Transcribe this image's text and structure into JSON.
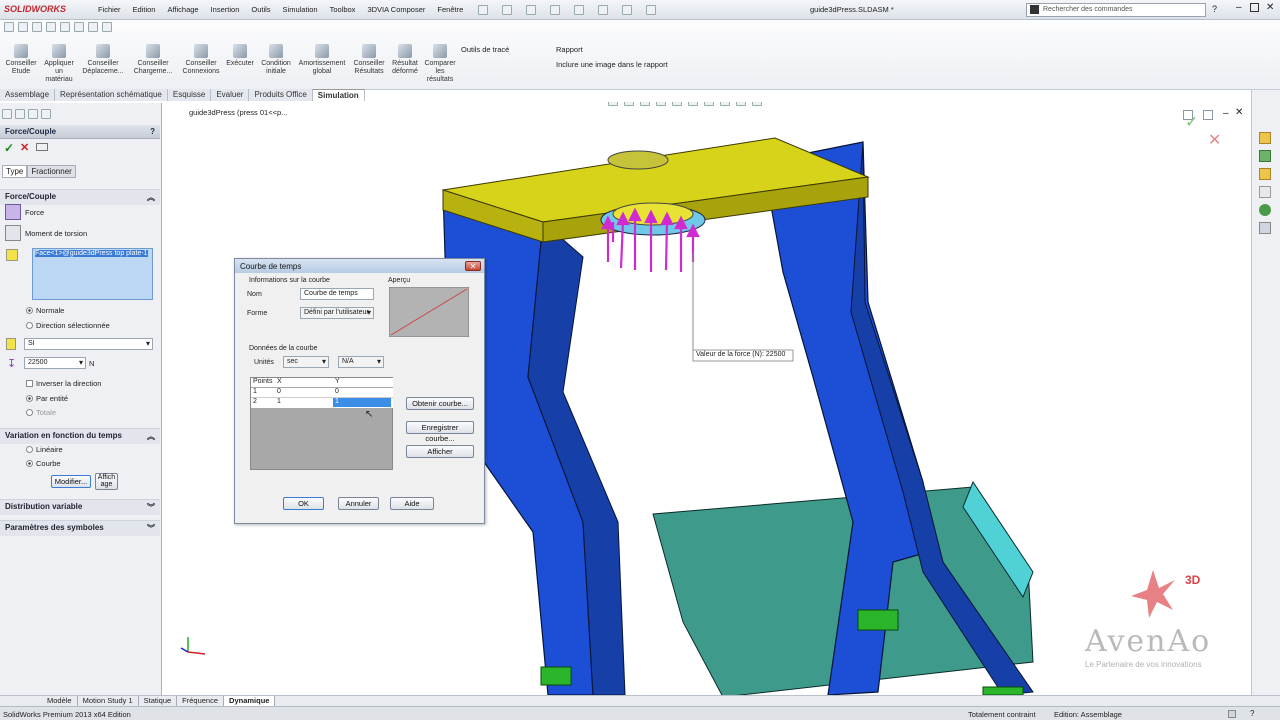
{
  "app": {
    "logo": "SOLIDWORKS",
    "doc_title": "guide3dPress.SLDASM *"
  },
  "menu": [
    "Fichier",
    "Edition",
    "Affichage",
    "Insertion",
    "Outils",
    "Simulation",
    "Toolbox",
    "3DVIA Composer",
    "Fenêtre"
  ],
  "search": {
    "placeholder": "Rechercher des commandes"
  },
  "ribbon": {
    "buttons": [
      {
        "label": "Conseiller Etude"
      },
      {
        "label": "Appliquer un matériau"
      },
      {
        "label": "Conseiller Déplaceme..."
      },
      {
        "label": "Conseiller Chargeme..."
      },
      {
        "label": "Conseiller Connexions"
      },
      {
        "label": "Exécuter"
      },
      {
        "label": "Condition initiale"
      },
      {
        "label": "Amortissement global"
      },
      {
        "label": "Conseiller Résultats"
      },
      {
        "label": "Résultat déformé"
      },
      {
        "label": "Comparer les résultats"
      }
    ],
    "outils_trace": "Outils de tracé",
    "rapport": "Rapport",
    "inclure_image": "Inclure une image dans le rapport"
  },
  "tabs": [
    {
      "label": "Assemblage",
      "active": false
    },
    {
      "label": "Représentation schématique",
      "active": false
    },
    {
      "label": "Esquisse",
      "active": false
    },
    {
      "label": "Evaluer",
      "active": false
    },
    {
      "label": "Produits Office",
      "active": false
    },
    {
      "label": "Simulation",
      "active": true
    }
  ],
  "panel": {
    "title": "Force/Couple",
    "help": "?",
    "subtabs": [
      "Type",
      "Fractionner"
    ],
    "section1": "Force/Couple",
    "force": "Force",
    "moment": "Moment de torsion",
    "face_ref": "Face<1>@guide3dPress top plate-1",
    "normale": "Normale",
    "direction": "Direction sélectionnée",
    "units": "SI",
    "value": "22500",
    "value_unit": "N",
    "inverser": "Inverser la direction",
    "par_entite": "Par entité",
    "totale": "Totale",
    "section2": "Variation en fonction du temps",
    "lineaire": "Linéaire",
    "courbe": "Courbe",
    "modifier": "Modifier...",
    "afficher": "Affich age",
    "section3": "Distribution variable",
    "section4": "Paramètres des symboles"
  },
  "viewport": {
    "tree_label": "guide3dPress  (press 01<<p...",
    "force_callout_label": "Valeur de la force (N):",
    "force_callout_value": "22500"
  },
  "dialog": {
    "title": "Courbe de temps",
    "info_group": "Informations sur la courbe",
    "nom_label": "Nom",
    "nom_value": "Courbe de temps",
    "forme_label": "Forme",
    "forme_value": "Défini par l'utilisateur",
    "apercu": "Aperçu",
    "data_group": "Données de la courbe",
    "unites_label": "Unités",
    "unit_x": "sec",
    "unit_y": "N/A",
    "columns": [
      "Points",
      "X",
      "Y"
    ],
    "rows": [
      {
        "p": "1",
        "x": "0",
        "y": "0"
      },
      {
        "p": "2",
        "x": "1",
        "y": "1"
      }
    ],
    "obtenir": "Obtenir courbe...",
    "enregistrer": "Enregistrer courbe...",
    "afficher": "Afficher",
    "ok": "OK",
    "annuler": "Annuler",
    "aide": "Aide"
  },
  "watermark": {
    "brand": "AvenAo",
    "three_d": "3D",
    "tagline": "Le Partenaire de vos innovations"
  },
  "bottom_tabs": [
    {
      "label": "Modèle",
      "active": false
    },
    {
      "label": "Motion Study 1",
      "active": false
    },
    {
      "label": "Statique",
      "active": false
    },
    {
      "label": "Fréquence",
      "active": false
    },
    {
      "label": "Dynamique",
      "active": true
    }
  ],
  "status": {
    "left": "SolidWorks Premium 2013 x64 Edition",
    "constraint": "Totalement contraint",
    "mode": "Edition: Assemblage"
  },
  "colors": {
    "part_blue": "#1d4fd6",
    "plate_yellow": "#d7d21a",
    "bracket_teal": "#3e9b8c",
    "arrow_magenta": "#d02bd0",
    "fixture_green": "#2bb52b",
    "brand_red": "#d9444a"
  }
}
